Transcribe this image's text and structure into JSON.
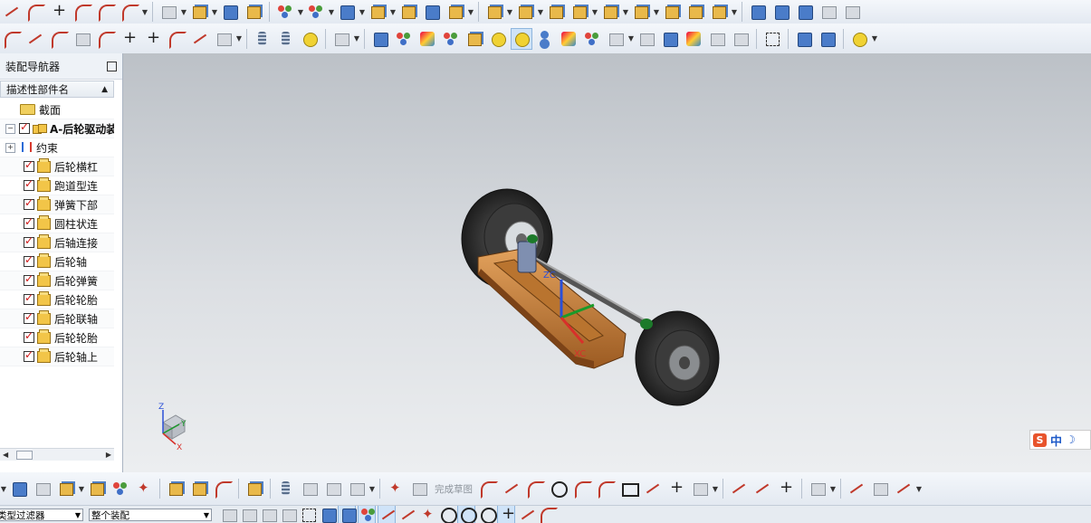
{
  "navigator": {
    "title": "装配导航器",
    "column_header": "描述性部件名",
    "tree": [
      {
        "label": "截面",
        "icon": "folder-icon",
        "level": 1,
        "checked": false
      },
      {
        "label": "A-后轮驱动装",
        "icon": "assembly-icon",
        "level": 0,
        "checked": true,
        "bold": true,
        "expander": "−"
      },
      {
        "label": "约束",
        "icon": "constraint-icon",
        "level": 1,
        "checked": false,
        "expander": "+"
      },
      {
        "label": "后轮横杠",
        "icon": "part-icon",
        "level": 2,
        "checked": true
      },
      {
        "label": "跑道型连",
        "icon": "part-icon",
        "level": 2,
        "checked": true
      },
      {
        "label": "弹簧下部",
        "icon": "part-icon",
        "level": 2,
        "checked": true
      },
      {
        "label": "圆柱状连",
        "icon": "part-icon",
        "level": 2,
        "checked": true
      },
      {
        "label": "后轴连接",
        "icon": "part-icon",
        "level": 2,
        "checked": true
      },
      {
        "label": "后轮轴",
        "icon": "part-icon",
        "level": 2,
        "checked": true
      },
      {
        "label": "后轮弹簧",
        "icon": "part-icon",
        "level": 2,
        "checked": true
      },
      {
        "label": "后轮轮胎",
        "icon": "part-icon",
        "level": 2,
        "checked": true
      },
      {
        "label": "后轮联轴",
        "icon": "part-icon",
        "level": 2,
        "checked": true
      },
      {
        "label": "后轮轮胎",
        "icon": "part-icon",
        "level": 2,
        "checked": true
      },
      {
        "label": "后轮轴上",
        "icon": "part-icon",
        "level": 2,
        "checked": true
      }
    ]
  },
  "viewport": {
    "triad": {
      "z": "Z",
      "y": "Y",
      "x": "X"
    },
    "model_csys": {
      "z": "ZC",
      "x": "XC"
    }
  },
  "ime": {
    "brand": "S",
    "mode": "中"
  },
  "sketch_toolbar": {
    "finish_sketch_label": "完成草图"
  },
  "status_bar": {
    "filter_label": "类型过滤器",
    "scope_label": "整个装配"
  },
  "colors": {
    "frame": "#c8803a",
    "tire": "#2b2b2b",
    "accent": "#d01818"
  }
}
